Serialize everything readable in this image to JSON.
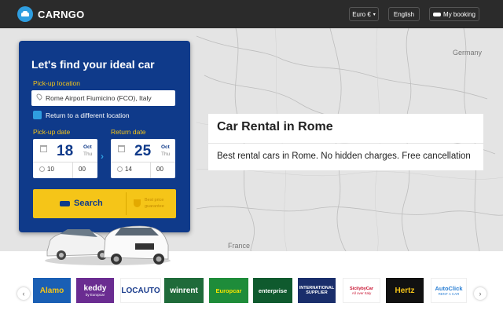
{
  "header": {
    "brand": "CARNGO",
    "currency": "Euro €",
    "language": "English",
    "my_booking": "My booking"
  },
  "map": {
    "labels": [
      "Germany",
      "France"
    ]
  },
  "search_panel": {
    "title": "Let's find your ideal car",
    "pickup_location_label": "Pick-up location",
    "pickup_location_value": "Rome Airport Fiumicino (FCO), Italy",
    "return_different_label": "Return to a different location",
    "pickup_date_label": "Pick-up date",
    "return_date_label": "Return date",
    "pickup": {
      "day": "18",
      "month": "Oct",
      "weekday": "Thu",
      "hour": "10",
      "minute": "00"
    },
    "return": {
      "day": "25",
      "month": "Oct",
      "weekday": "Thu",
      "hour": "14",
      "minute": "00"
    },
    "search_label": "Search",
    "guarantee": "Best price guarantee"
  },
  "hero": {
    "title": "Car Rental in Rome",
    "subtitle": "Best rental cars in Rome. No hidden charges. Free cancellation"
  },
  "partners": [
    {
      "name": "Alamo",
      "bg": "#1a5fb4",
      "fg": "#f5c518"
    },
    {
      "name": "keddy",
      "sub": "by Europcar",
      "bg": "#6a2c91",
      "fg": "#ffffff"
    },
    {
      "name": "LOCAUTO",
      "bg": "#ffffff",
      "fg": "#1a3c8c"
    },
    {
      "name": "winrent",
      "bg": "#1f6b3a",
      "fg": "#ffffff"
    },
    {
      "name": "Europcar",
      "bg": "#1e8c3a",
      "fg": "#f5e400"
    },
    {
      "name": "enterprise",
      "bg": "#0f5a2e",
      "fg": "#ffffff"
    },
    {
      "name": "INTERNATIONAL SUPPLIER",
      "bg": "#1a2e6b",
      "fg": "#ffffff"
    },
    {
      "name": "SicilybyCar",
      "sub": "All over Italy",
      "bg": "#ffffff",
      "fg": "#c8102e"
    },
    {
      "name": "Hertz",
      "bg": "#111111",
      "fg": "#f5c518"
    },
    {
      "name": "AutoClick",
      "sub": "RENT A CAR",
      "bg": "#ffffff",
      "fg": "#2a7fd4"
    }
  ],
  "colors": {
    "panel": "#0f3a8a",
    "accent": "#f5c518",
    "topbar": "#2b2b2b"
  }
}
